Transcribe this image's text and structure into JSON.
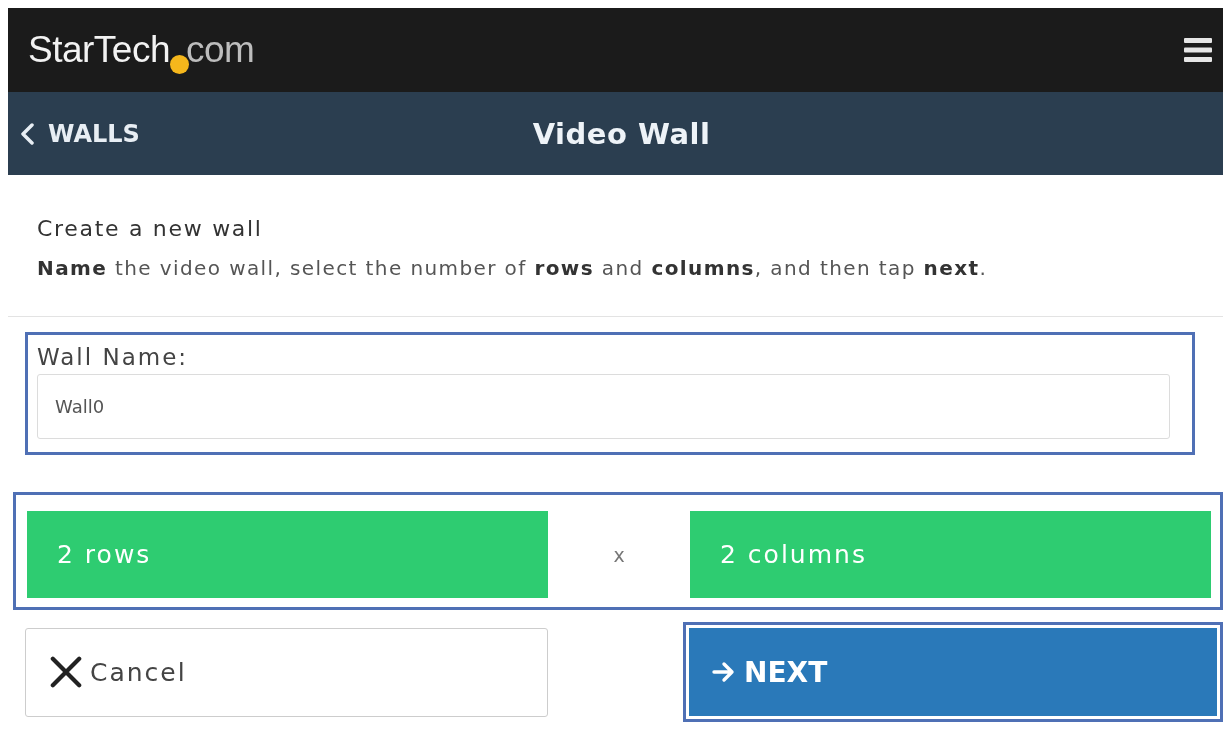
{
  "header": {
    "logo": {
      "name": "StarTech",
      "domain": "com"
    }
  },
  "nav": {
    "back": "WALLS",
    "title": "Video Wall"
  },
  "intro": {
    "heading": "Create a new wall",
    "text": "**Name** the video wall, select the number of **rows** and **columns**, and then tap **next**."
  },
  "wall_name": {
    "label": "Wall Name:",
    "value": "Wall0",
    "highlighted": true
  },
  "dimensions": {
    "rows": "2 rows",
    "separator": "x",
    "columns": "2 columns",
    "highlighted": true
  },
  "buttons": [
    {
      "kind": "cancel",
      "label": "Cancel",
      "highlighted": false
    },
    {
      "kind": "next",
      "label": "NEXT",
      "highlighted": true
    }
  ]
}
